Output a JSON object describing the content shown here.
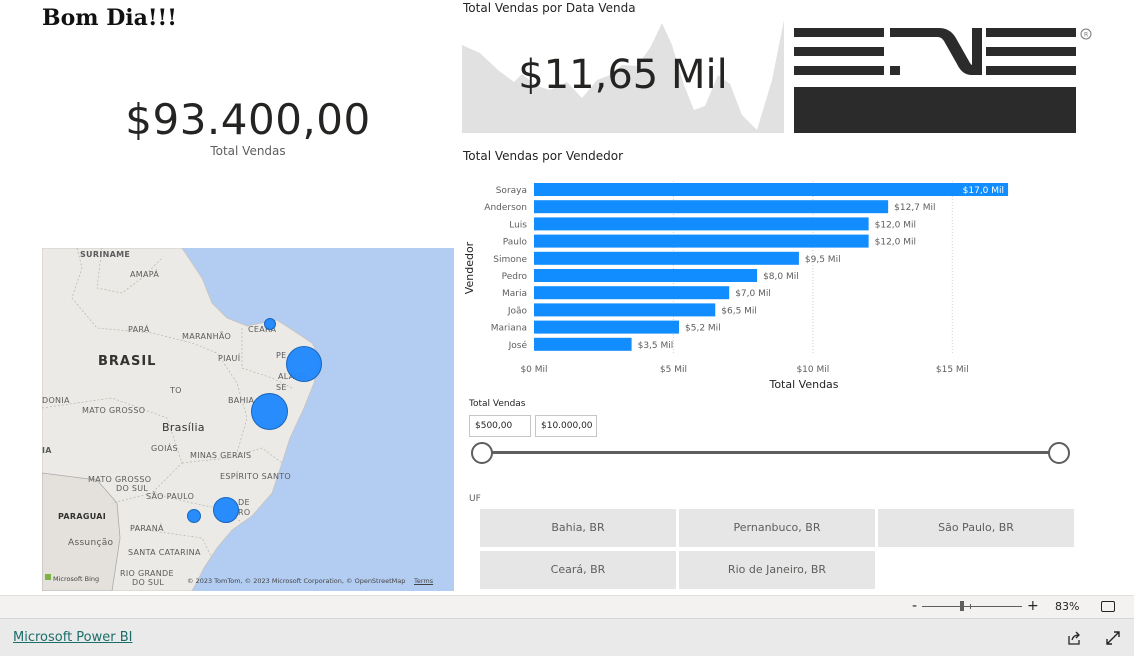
{
  "greeting": "Bom Dia!!!",
  "total_card": {
    "value": "$93.400,00",
    "label": "Total Vendas"
  },
  "sparkline": {
    "title": "Total Vendas por Data Venda",
    "value": "$11,65 Mil"
  },
  "bar_chart": {
    "title": "Total Vendas por Vendedor",
    "xlabel": "Total Vendas",
    "ylabel": "Vendedor"
  },
  "chart_data": {
    "type": "bar",
    "orientation": "horizontal",
    "title": "Total Vendas por Vendedor",
    "xlabel": "Total Vendas",
    "ylabel": "Vendedor",
    "categories": [
      "Soraya",
      "Anderson",
      "Luis",
      "Paulo",
      "Simone",
      "Pedro",
      "Maria",
      "João",
      "Mariana",
      "José"
    ],
    "values": [
      17.0,
      12.7,
      12.0,
      12.0,
      9.5,
      8.0,
      7.0,
      6.5,
      5.2,
      3.5
    ],
    "data_labels": [
      "$17,0 Mil",
      "$12,7 Mil",
      "$12,0 Mil",
      "$12,0 Mil",
      "$9,5 Mil",
      "$8,0 Mil",
      "$7,0 Mil",
      "$6,5 Mil",
      "$5,2 Mil",
      "$3,5 Mil"
    ],
    "xticks": [
      "$0 Mil",
      "$5 Mil",
      "$10 Mil",
      "$15 Mil"
    ],
    "xtick_values": [
      0,
      5,
      10,
      15
    ],
    "xlim": [
      0,
      17.5
    ],
    "grid": true,
    "color": "#118dff"
  },
  "slicer": {
    "title": "Total Vendas",
    "min": "$500,00",
    "max": "$10.000,00"
  },
  "uf_slicer": {
    "title": "UF",
    "tiles": [
      "Bahia, BR",
      "Pernanbuco, BR",
      "São Paulo, BR",
      "Ceará, BR",
      "Rio de Janeiro, BR"
    ]
  },
  "map": {
    "labels": {
      "suriname": "SURINAME",
      "amapa": "AMAPÁ",
      "para": "PARÁ",
      "maranhao": "MARANHÃO",
      "ceara": "CEARÁ",
      "pa": "PA",
      "pe": "PE",
      "piaui": "PIAUÍ",
      "alagoas": "ALAGO",
      "se": "SE",
      "brasil": "BRASIL",
      "to": "TO",
      "bahia": "BAHIA",
      "donia": "DONIA",
      "mato_grosso": "MATO GROSSO",
      "brasilia": "Brasília",
      "ia": "IA",
      "goias": "GOIÁS",
      "minas": "MINAS GERAIS",
      "espirito": "ESPÍRITO SANTO",
      "ms1": "MATO GROSSO",
      "ms2": "DO SUL",
      "sao_paulo": "SÃO PAULO",
      "rj_de": "DE",
      "rj_ro": "RO",
      "paraguai": "PARAGUAI",
      "parana": "PARANÁ",
      "assuncao": "Assunção",
      "santa_catarina": "SANTA CATARINA",
      "rio_grande": "RIO GRANDE",
      "do_sul": "DO SUL"
    },
    "logo_text": "Microsoft Bing",
    "credit": "© 2023 TomTom, © 2023 Microsoft Corporation, © OpenStreetMap",
    "credit_link": "Terms"
  },
  "zoom": {
    "minus": "-",
    "plus": "+",
    "percent": "83%"
  },
  "footer": {
    "link": "Microsoft Power BI"
  },
  "colors": {
    "bar": "#118dff",
    "bubble": "#1e88ff",
    "sea": "#b3cdf2",
    "land": "#ececec"
  }
}
